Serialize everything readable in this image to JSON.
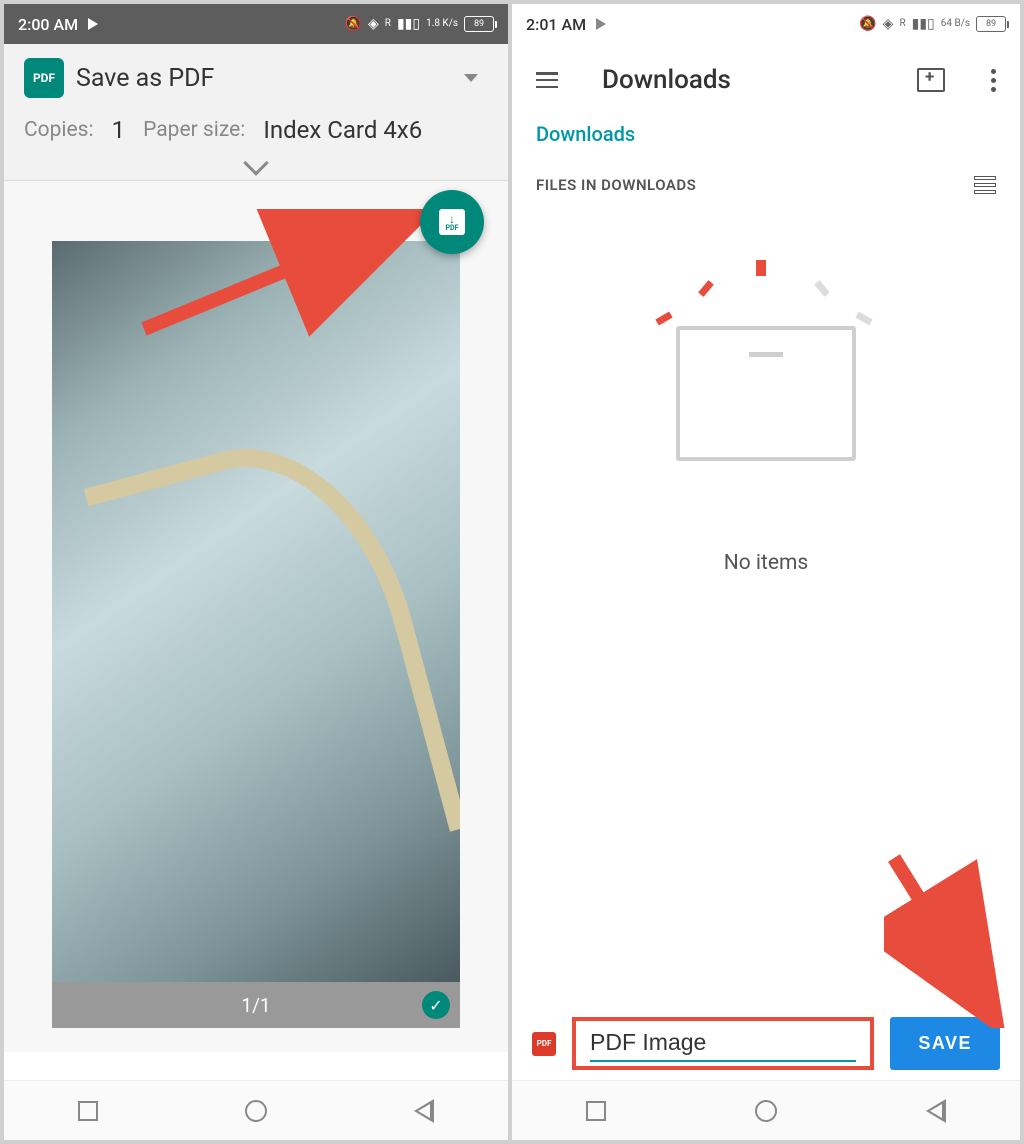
{
  "left": {
    "status": {
      "time": "2:00 AM",
      "speed": "1.8 K/s",
      "battery": "89",
      "network": "R"
    },
    "print": {
      "title": "Save as PDF",
      "copies_label": "Copies:",
      "copies_value": "1",
      "paper_label": "Paper size:",
      "paper_value": "Index Card 4x6"
    },
    "preview": {
      "page_indicator": "1/1"
    }
  },
  "right": {
    "status": {
      "time": "2:01 AM",
      "speed": "64 B/s",
      "battery": "89",
      "network": "R"
    },
    "header": {
      "title": "Downloads"
    },
    "breadcrumb": "Downloads",
    "section_title": "FILES IN DOWNLOADS",
    "empty_text": "No items",
    "filename": "PDF Image",
    "save_label": "SAVE"
  }
}
